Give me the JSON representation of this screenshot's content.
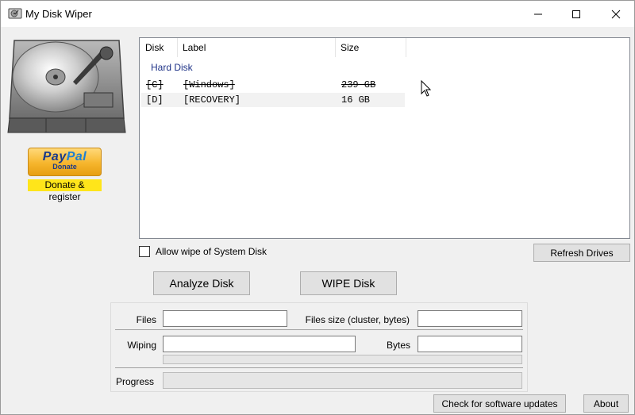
{
  "window": {
    "title": "My Disk Wiper"
  },
  "sidebar": {
    "paypal_logo_pay": "Pay",
    "paypal_logo_pal": "Pal",
    "paypal_sub": "Donate",
    "donate_label": "Donate & register"
  },
  "disk_list": {
    "columns": [
      "Disk",
      "Label",
      "Size"
    ],
    "group": "Hard Disk",
    "rows": [
      {
        "disk": "[C]",
        "label": "[Windows]",
        "size": "239 GB",
        "struck": true
      },
      {
        "disk": "[D]",
        "label": "[RECOVERY]",
        "size": "16 GB",
        "struck": false
      }
    ]
  },
  "options": {
    "allow_wipe_label": "Allow wipe of System Disk",
    "allow_wipe_checked": false
  },
  "buttons": {
    "refresh": "Refresh Drives",
    "analyze": "Analyze Disk",
    "wipe": "WIPE Disk",
    "updates": "Check for software updates",
    "about": "About"
  },
  "info": {
    "files_label": "Files",
    "files_value": "",
    "files_size_label": "Files size (cluster, bytes)",
    "files_size_value": "",
    "wiping_label": "Wiping",
    "wiping_value": "",
    "bytes_label": "Bytes",
    "bytes_value": "",
    "progress_label": "Progress",
    "wiping_progress": 0,
    "overall_progress": 0
  }
}
